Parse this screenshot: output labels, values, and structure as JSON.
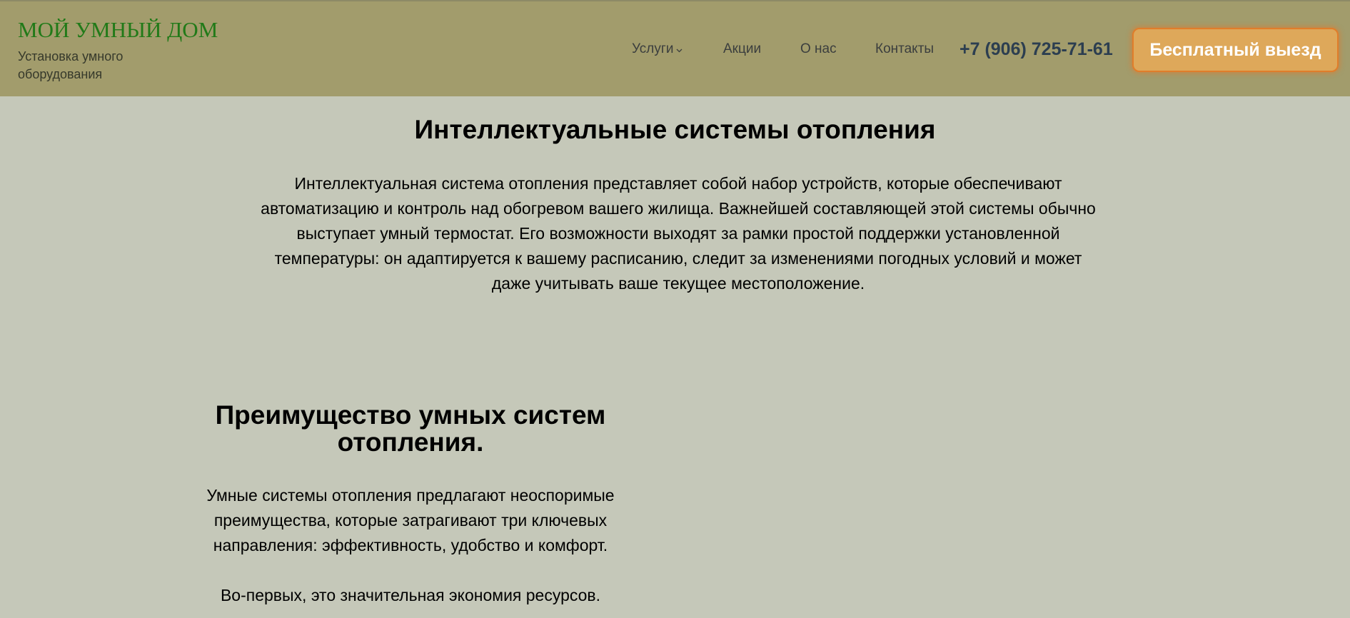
{
  "header": {
    "brand_title": "МОЙ УМНЫЙ ДОМ",
    "brand_subtitle": "Установка умного оборудования",
    "nav": {
      "services": "Услуги",
      "promo": "Акции",
      "about": "О нас",
      "contacts": "Контакты"
    },
    "phone": "+7 (906) 725-71-61",
    "cta_label": "Бесплатный выезд"
  },
  "main": {
    "title": "Интеллектуальные системы отопления",
    "lead": "Интеллектуальная система отопления представляет собой набор устройств, которые обеспечивают автоматизацию и контроль над обогревом вашего жилища. Важнейшей составляющей этой системы обычно выступает умный термостат. Его возможности выходят за рамки простой поддержки установленной температуры: он адаптируется к вашему расписанию, следит за изменениями погодных условий и может даже учитывать ваше текущее местоположение.",
    "advantages_title": "Преимущество умных систем отопления.",
    "advantages_intro": "Умные системы отопления предлагают неоспоримые преимущества, которые затрагивают три ключевых направления: эффективность, удобство и комфорт.",
    "advantages_first": "Во-первых, это значительная экономия ресурсов."
  },
  "colors": {
    "header_bg": "#a29c6c",
    "page_bg": "#c5c8b9",
    "brand": "#217a18",
    "cta_bg": "#dea85a",
    "cta_border": "#e07d2a"
  }
}
